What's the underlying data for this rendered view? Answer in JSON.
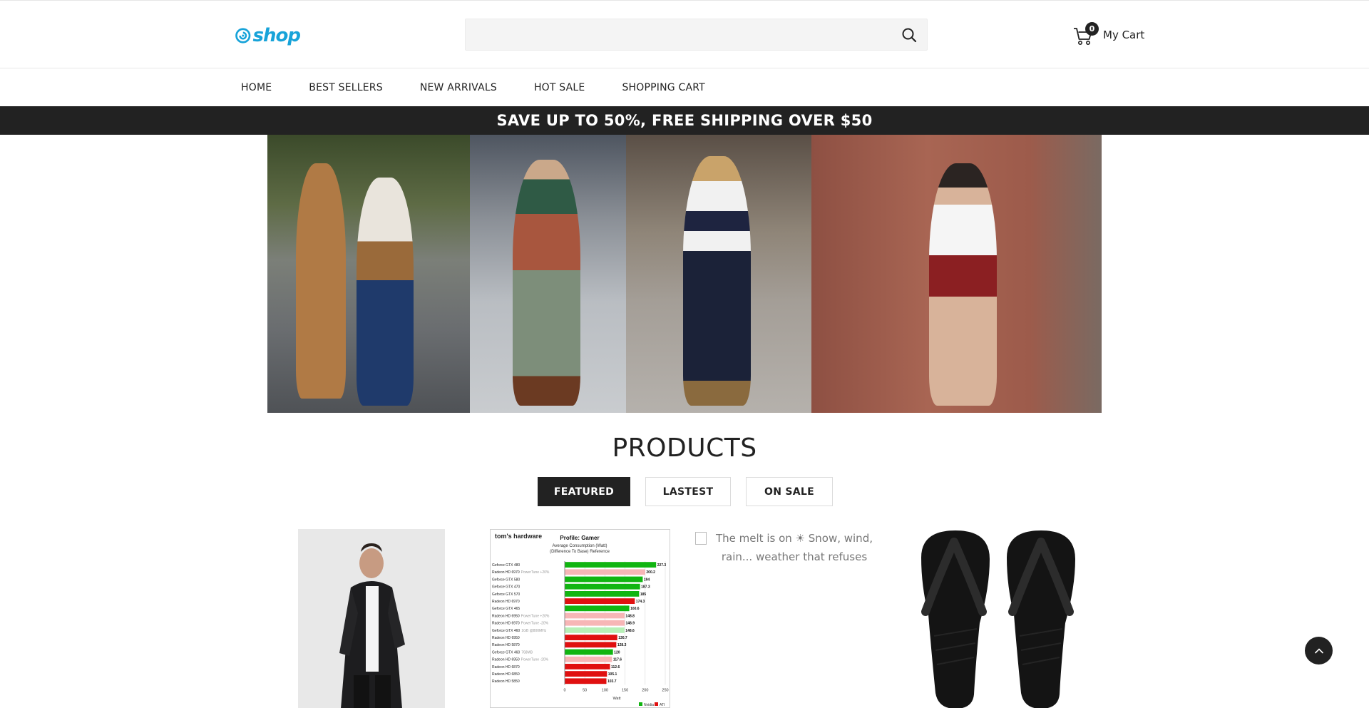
{
  "header": {
    "logo_text": "shop",
    "search_placeholder": "",
    "cart_count": "0",
    "cart_label": "My Cart",
    "accent_color": "#17a3d9"
  },
  "nav": {
    "items": [
      "HOME",
      "BEST SELLERS",
      "NEW ARRIVALS",
      "HOT SALE",
      "SHOPPING CART"
    ]
  },
  "promo": {
    "text": "SAVE UP TO 50%, FREE SHIPPING OVER $50"
  },
  "products": {
    "title": "PRODUCTS",
    "tabs": [
      "FEATURED",
      "LASTEST",
      "ON SALE"
    ],
    "active_tab": "FEATURED",
    "broken_image_alt": "The melt is on ☀ Snow, wind, rain... weather that refuses"
  },
  "chart_data": {
    "type": "bar",
    "brand": "tom's hardware",
    "title": "Profile: Gamer",
    "subtitle": "Average Consumption (Watt)",
    "subtitle2": "(Difference To Base) Reference",
    "xlabel": "Watt",
    "xlim": [
      0,
      250
    ],
    "xticks": [
      "0",
      "50",
      "100",
      "150",
      "200",
      "250"
    ],
    "categories": [
      "Geforce GTX 480",
      "Radeon HD 6970",
      "Geforce GTX 580",
      "Geforce GTX 470",
      "Geforce GTX 570",
      "Radeon HD 6970",
      "Geforce GTX 465",
      "Radeon HD 6950",
      "Radeon HD 6970",
      "Geforce GTX 460",
      "Radeon HD 6950",
      "Radeon HD 5870",
      "Geforce GTX 460",
      "Radeon HD 6950",
      "Radeon HD 6870",
      "Radeon HD 6850",
      "Radeon HD 5850"
    ],
    "notes": [
      "",
      "PowerTune +20%",
      "",
      "",
      "",
      "",
      "",
      "PowerTune +20%",
      "PowerTune -20%",
      "1GB @800MHz",
      "",
      "",
      "768MB",
      "PowerTune -20%",
      "",
      "",
      ""
    ],
    "values": [
      227.3,
      200.2,
      194,
      187.3,
      185,
      174.3,
      160.6,
      148.8,
      148.9,
      148.6,
      130.7,
      128.3,
      120,
      117.6,
      112.6,
      105.1,
      103.7
    ],
    "value_labels": [
      "227.3",
      "200.2",
      "194",
      "187.3",
      "185",
      "174.3",
      "160.6",
      "148.8",
      "148.9",
      "148.6",
      "130.7",
      "128.3",
      "120",
      "117.6",
      "112.6",
      "105.1",
      "103.7"
    ],
    "colors": [
      "#11b511",
      "#f7b6b6",
      "#11b511",
      "#11b511",
      "#11b511",
      "#e01010",
      "#11b511",
      "#f7b6b6",
      "#f7b6b6",
      "#b7f0b7",
      "#e01010",
      "#e01010",
      "#11b511",
      "#f7b6b6",
      "#e01010",
      "#e01010",
      "#e01010"
    ],
    "legend": [
      "Nvidia",
      "ATI"
    ],
    "legend_colors": [
      "#11b511",
      "#e01010"
    ]
  }
}
